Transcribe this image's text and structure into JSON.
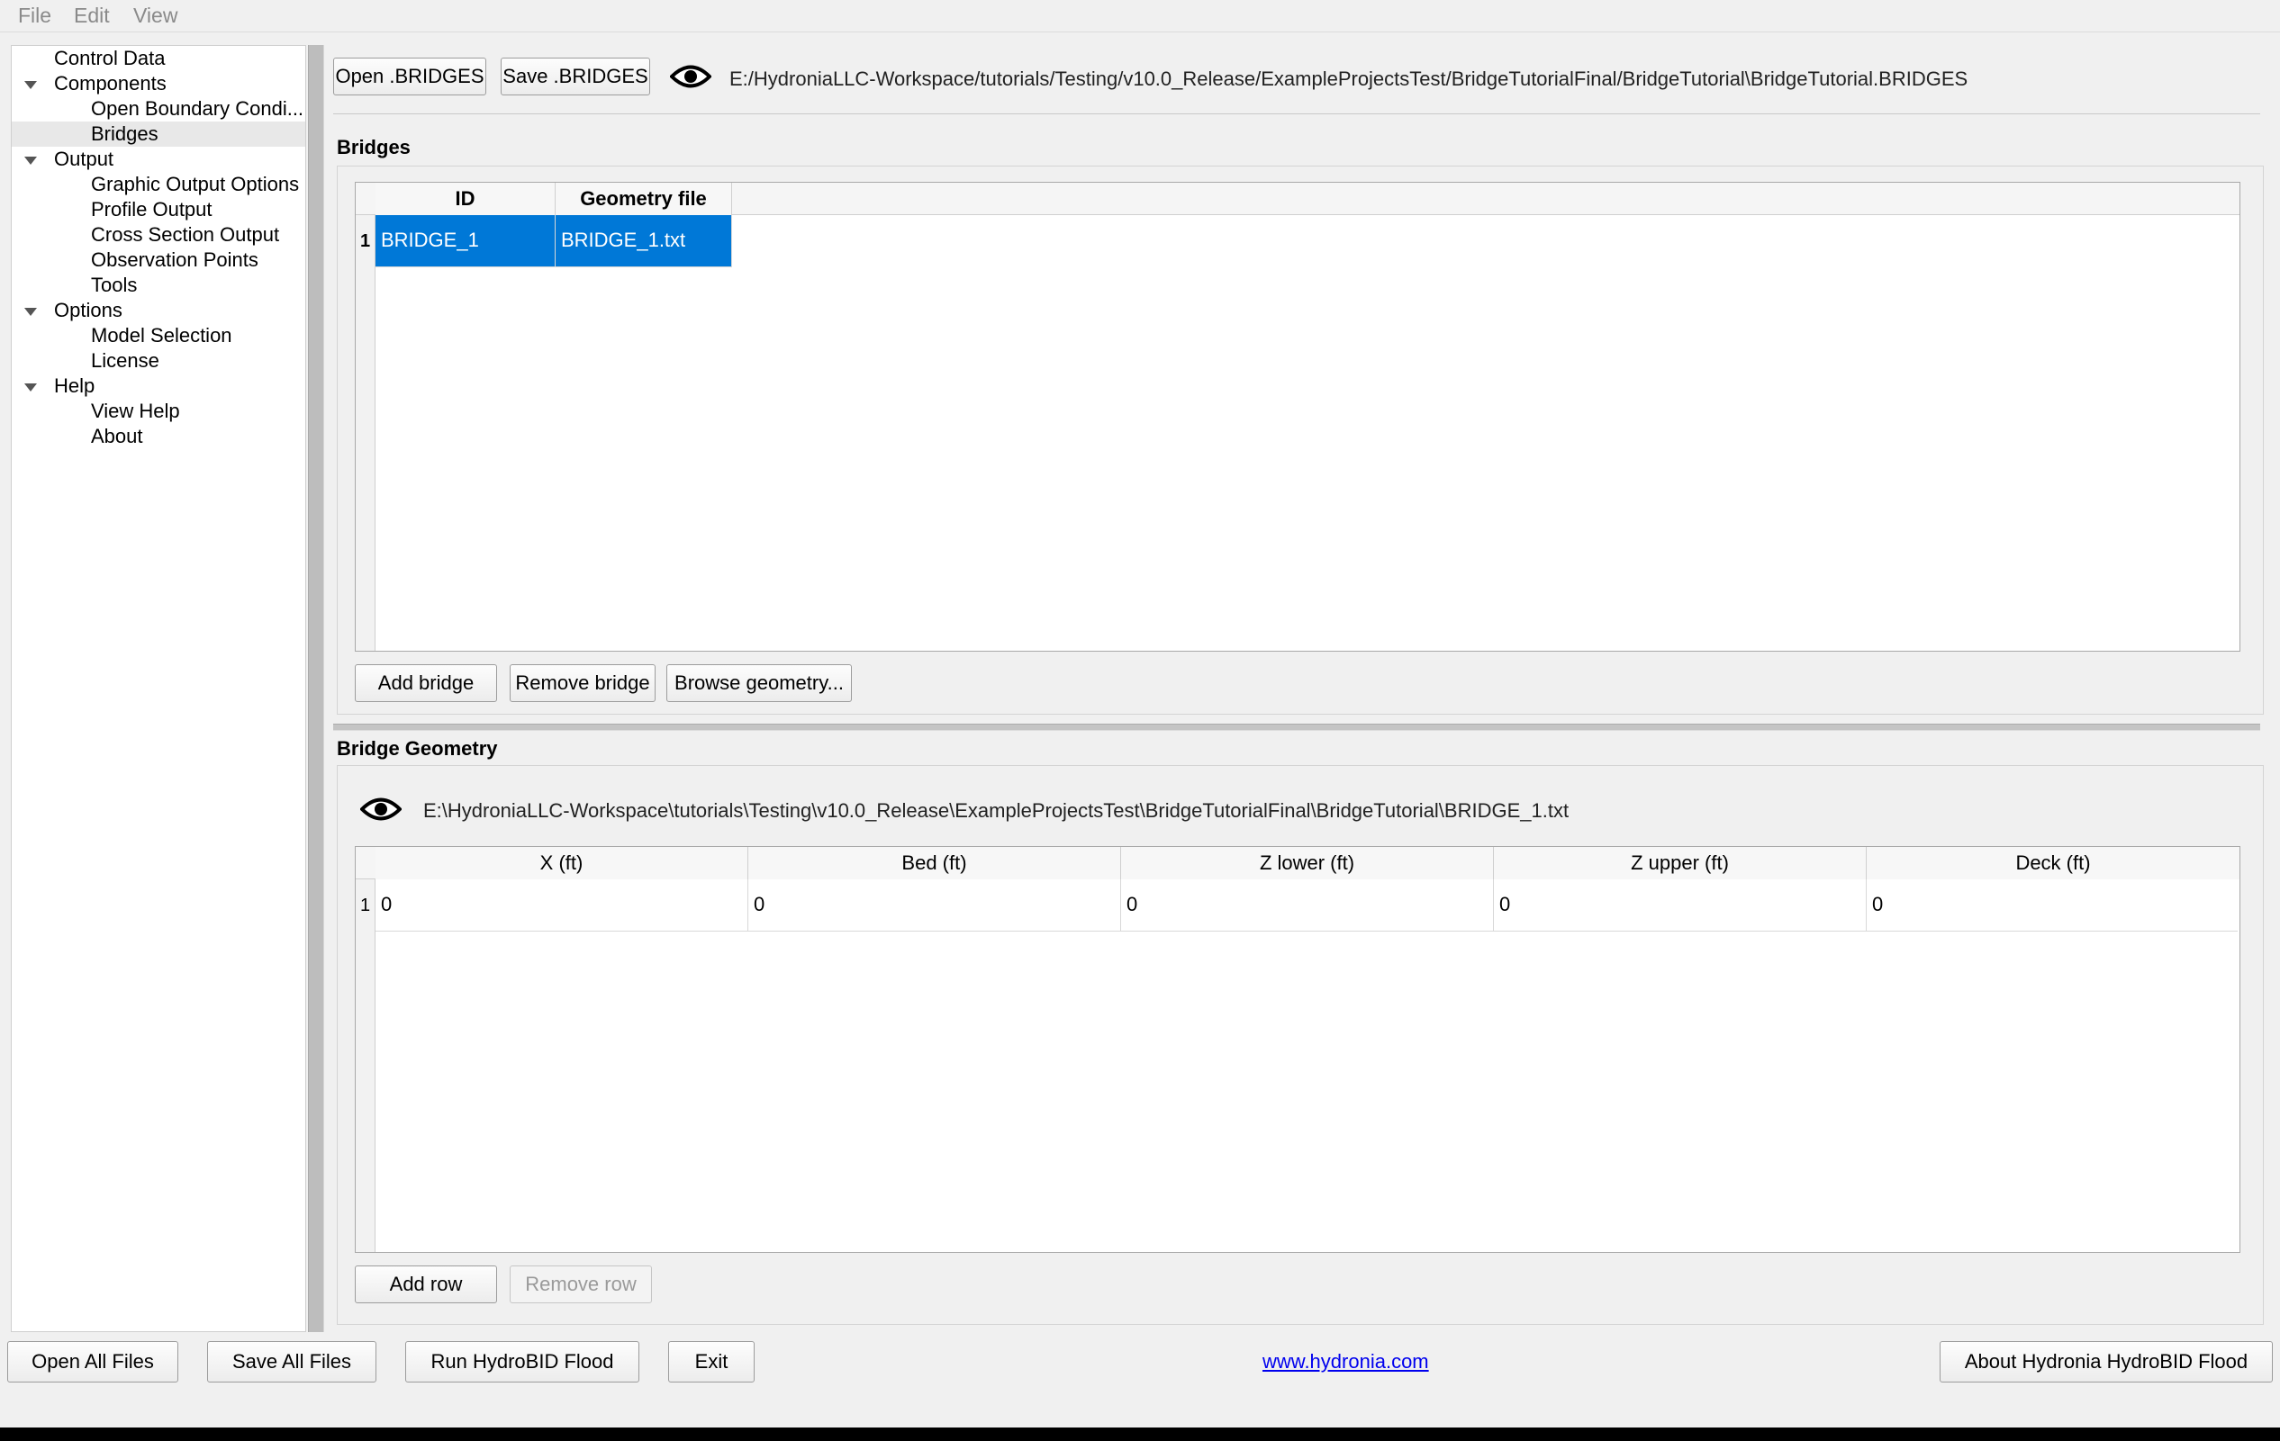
{
  "menu": {
    "file": "File",
    "edit": "Edit",
    "view": "View"
  },
  "sidebar": {
    "items": [
      {
        "label": "Control Data"
      },
      {
        "label": "Components"
      },
      {
        "label": "Open Boundary Condi..."
      },
      {
        "label": "Bridges"
      },
      {
        "label": "Output"
      },
      {
        "label": "Graphic Output Options"
      },
      {
        "label": "Profile Output"
      },
      {
        "label": "Cross Section Output"
      },
      {
        "label": "Observation Points"
      },
      {
        "label": "Tools"
      },
      {
        "label": "Options"
      },
      {
        "label": "Model Selection"
      },
      {
        "label": "License"
      },
      {
        "label": "Help"
      },
      {
        "label": "View Help"
      },
      {
        "label": "About"
      }
    ]
  },
  "toolbar": {
    "open_label": "Open .BRIDGES",
    "save_label": "Save .BRIDGES",
    "file_path": "E:/HydroniaLLC-Workspace/tutorials/Testing/v10.0_Release/ExampleProjectsTest/BridgeTutorialFinal/BridgeTutorial\\BridgeTutorial.BRIDGES",
    "eye_icon": "eye-icon"
  },
  "bridges": {
    "title": "Bridges",
    "columns": [
      "ID",
      "Geometry file"
    ],
    "rows": [
      {
        "num": "1",
        "id": "BRIDGE_1",
        "geometry": "BRIDGE_1.txt"
      }
    ],
    "add_label": "Add bridge",
    "remove_label": "Remove bridge",
    "browse_label": "Browse geometry..."
  },
  "geometry": {
    "title": "Bridge Geometry",
    "file_path": "E:\\HydroniaLLC-Workspace\\tutorials\\Testing\\v10.0_Release\\ExampleProjectsTest\\BridgeTutorialFinal\\BridgeTutorial\\BRIDGE_1.txt",
    "columns": [
      "X (ft)",
      "Bed (ft)",
      "Z lower (ft)",
      "Z upper (ft)",
      "Deck (ft)"
    ],
    "rows": [
      {
        "num": "1",
        "cells": [
          "0",
          "0",
          "0",
          "0",
          "0"
        ]
      }
    ],
    "add_label": "Add row",
    "remove_label": "Remove row"
  },
  "footer": {
    "open_all": "Open All Files",
    "save_all": "Save All Files",
    "run": "Run HydroBID Flood",
    "exit": "Exit",
    "link": "www.hydronia.com",
    "about": "About Hydronia HydroBID Flood"
  },
  "colors": {
    "selection": "#0078d7",
    "link": "#0000ee"
  }
}
